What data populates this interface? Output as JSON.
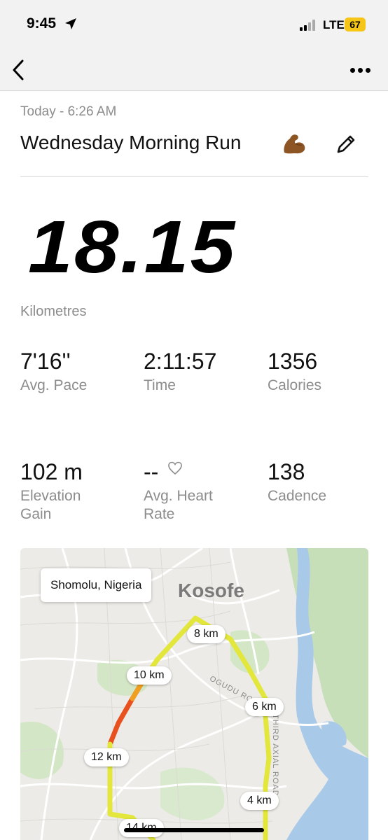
{
  "status": {
    "time": "9:45",
    "network": "LTE",
    "battery": "67"
  },
  "nav": {
    "back_icon": "chevron-left-icon",
    "more_icon": "more-horizontal-icon"
  },
  "activity": {
    "subtitle": "Today - 6:26 AM",
    "title": "Wednesday Morning Run",
    "title_emoji_icon": "flexed-biceps-icon",
    "edit_icon": "pencil-icon",
    "distance": "18.15",
    "distance_unit": "Kilometres"
  },
  "stats": [
    {
      "value": "7'16''",
      "label": "Avg. Pace"
    },
    {
      "value": "2:11:57",
      "label": "Time"
    },
    {
      "value": "1356",
      "label": "Calories"
    },
    {
      "value": "102 m",
      "label": "Elevation Gain"
    },
    {
      "value": "--",
      "label": "Avg. Heart Rate"
    },
    {
      "value": "138",
      "label": "Cadence"
    }
  ],
  "map": {
    "location": "Shomolu, Nigeria",
    "place_label": "Kosofe",
    "road_labels": [
      "OGUDU ROAD",
      "THIRD AXIAL ROAD"
    ],
    "km_markers": [
      "4 km",
      "6 km",
      "8 km",
      "10 km",
      "12 km",
      "14 km"
    ],
    "route_colors": {
      "fast": "#e6e63a",
      "medium": "#f0a020",
      "slow": "#e8501e"
    }
  }
}
